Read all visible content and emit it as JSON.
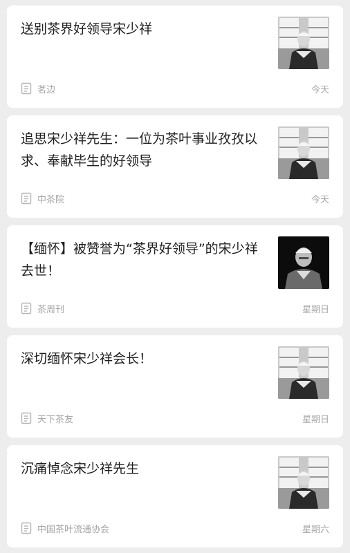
{
  "articles": [
    {
      "title": "送别茶界好领导宋少祥",
      "source": "茗边",
      "date": "今天",
      "thumbnail": "portrait-seated-bookshelf"
    },
    {
      "title": "追思宋少祥先生：一位为茶叶事业孜孜以求、奉献毕生的好领导",
      "source": "中茶院",
      "date": "今天",
      "thumbnail": "portrait-seated-bookshelf"
    },
    {
      "title": "【缅怀】被赞誉为“茶界好领导”的宋少祥去世！",
      "source": "茶周刊",
      "date": "星期日",
      "thumbnail": "portrait-dark-background"
    },
    {
      "title": "深切缅怀宋少祥会长！",
      "source": "天下茶友",
      "date": "星期日",
      "thumbnail": "portrait-seated-bookshelf"
    },
    {
      "title": "沉痛悼念宋少祥先生",
      "source": "中国茶叶流通协会",
      "date": "星期六",
      "thumbnail": "portrait-seated-bookshelf"
    }
  ],
  "icons": {
    "source_icon": "document-icon"
  },
  "colors": {
    "background": "#ededed",
    "card": "#ffffff",
    "title_text": "#1f1f1f",
    "meta_text": "#a5a5a5"
  }
}
